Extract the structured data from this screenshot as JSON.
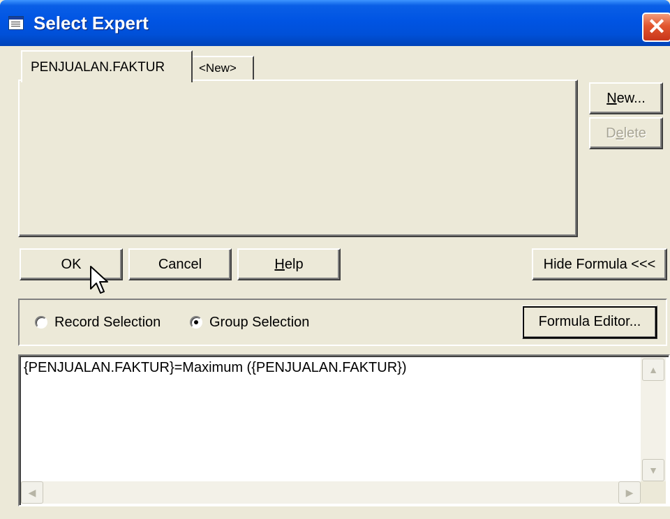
{
  "window": {
    "title": "Select Expert",
    "close_glyph": "✕"
  },
  "tabs": [
    {
      "label": "PENJUALAN.FAKTUR",
      "active": true
    },
    {
      "label": "<New>",
      "active": false
    }
  ],
  "side_buttons": {
    "new": {
      "prefix": "",
      "accel": "N",
      "rest": "ew..."
    },
    "delete": {
      "prefix": "D",
      "accel": "e",
      "rest": "lete",
      "disabled": true
    }
  },
  "action_buttons": {
    "ok": "OK",
    "cancel": "Cancel",
    "help": {
      "accel": "H",
      "rest": "elp"
    },
    "hide_formula": "Hide Formula <<<"
  },
  "selection": {
    "record_label": "Record Selection",
    "group_label": "Group Selection",
    "selected": "group"
  },
  "formula_editor_button": "Formula Editor...",
  "formula": {
    "text": "{PENJUALAN.FAKTUR}=Maximum ({PENJUALAN.FAKTUR})"
  },
  "scroll_glyphs": {
    "up": "▲",
    "down": "▼",
    "left": "◀",
    "right": "▶"
  },
  "icons": {
    "app": "report-window-icon",
    "close": "close-icon",
    "cursor": "mouse-pointer-icon"
  }
}
